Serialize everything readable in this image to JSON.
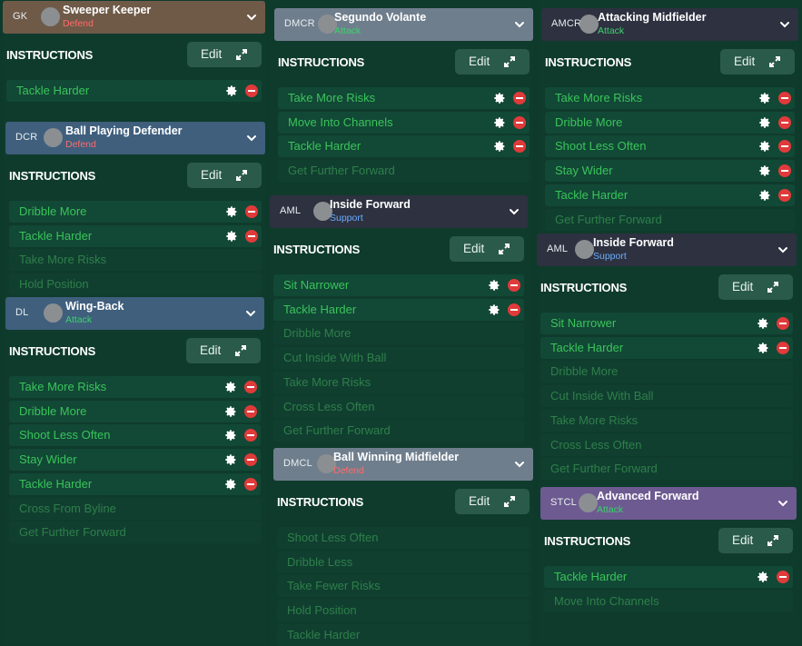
{
  "instructions_label": "INSTRUCTIONS",
  "edit_label": "Edit",
  "colors": {
    "defend": "#ff6b6b",
    "attack": "#3dd26a",
    "support": "#6aaeff",
    "instruction_active": "#39c45a",
    "instruction_inactive": "#2f7f4a"
  },
  "columns": [
    [
      {
        "pos": "GK",
        "role": "Sweeper Keeper",
        "duty": "Defend",
        "instructions": [
          {
            "label": "Tackle Harder",
            "active": true
          }
        ]
      },
      {
        "pos": "DCR",
        "role": "Ball Playing Defender",
        "duty": "Defend",
        "instructions": [
          {
            "label": "Dribble More",
            "active": true
          },
          {
            "label": "Tackle Harder",
            "active": true
          },
          {
            "label": "Take More Risks",
            "active": false
          },
          {
            "label": "Hold Position",
            "active": false
          }
        ]
      },
      {
        "pos": "DL",
        "role": "Wing-Back",
        "duty": "Attack",
        "instructions": [
          {
            "label": "Take More Risks",
            "active": true
          },
          {
            "label": "Dribble More",
            "active": true
          },
          {
            "label": "Shoot Less Often",
            "active": true
          },
          {
            "label": "Stay Wider",
            "active": true
          },
          {
            "label": "Tackle Harder",
            "active": true
          },
          {
            "label": "Cross From Byline",
            "active": false
          },
          {
            "label": "Get Further Forward",
            "active": false
          }
        ]
      }
    ],
    [
      {
        "pos": "DMCR",
        "role": "Segundo Volante",
        "duty": "Attack",
        "instructions": [
          {
            "label": "Take More Risks",
            "active": true
          },
          {
            "label": "Move Into Channels",
            "active": true
          },
          {
            "label": "Tackle Harder",
            "active": true
          },
          {
            "label": "Get Further Forward",
            "active": false
          }
        ]
      },
      {
        "pos": "AML",
        "role": "Inside Forward",
        "duty": "Support",
        "instructions": [
          {
            "label": "Sit Narrower",
            "active": true
          },
          {
            "label": "Tackle Harder",
            "active": true
          },
          {
            "label": "Dribble More",
            "active": false
          },
          {
            "label": "Cut Inside With Ball",
            "active": false
          },
          {
            "label": "Take More Risks",
            "active": false
          },
          {
            "label": "Cross Less Often",
            "active": false
          },
          {
            "label": "Get Further Forward",
            "active": false
          }
        ]
      },
      {
        "pos": "DMCL",
        "role": "Ball Winning Midfielder",
        "duty": "Defend",
        "instructions": [
          {
            "label": "Shoot Less Often",
            "active": false
          },
          {
            "label": "Dribble Less",
            "active": false
          },
          {
            "label": "Take Fewer Risks",
            "active": false
          },
          {
            "label": "Hold Position",
            "active": false
          },
          {
            "label": "Tackle Harder",
            "active": false
          }
        ]
      }
    ],
    [
      {
        "pos": "AMCR",
        "role": "Attacking Midfielder",
        "duty": "Attack",
        "instructions": [
          {
            "label": "Take More Risks",
            "active": true
          },
          {
            "label": "Dribble More",
            "active": true
          },
          {
            "label": "Shoot Less Often",
            "active": true
          },
          {
            "label": "Stay Wider",
            "active": true
          },
          {
            "label": "Tackle Harder",
            "active": true
          },
          {
            "label": "Get Further Forward",
            "active": false
          }
        ]
      },
      {
        "pos": "AML",
        "role": "Inside Forward",
        "duty": "Support",
        "instructions": [
          {
            "label": "Sit Narrower",
            "active": true
          },
          {
            "label": "Tackle Harder",
            "active": true
          },
          {
            "label": "Dribble More",
            "active": false
          },
          {
            "label": "Cut Inside With Ball",
            "active": false
          },
          {
            "label": "Take More Risks",
            "active": false
          },
          {
            "label": "Cross Less Often",
            "active": false
          },
          {
            "label": "Get Further Forward",
            "active": false
          }
        ]
      },
      {
        "pos": "STCL",
        "role": "Advanced Forward",
        "duty": "Attack",
        "instructions": [
          {
            "label": "Tackle Harder",
            "active": true
          },
          {
            "label": "Move Into Channels",
            "active": false
          }
        ]
      }
    ]
  ]
}
